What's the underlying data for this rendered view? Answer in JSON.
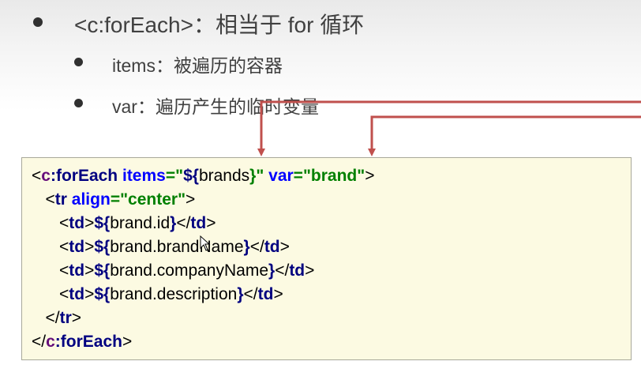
{
  "bullets": [
    {
      "text": "<c:forEach>：相当于 for 循环"
    },
    {
      "text": "items：被遍历的容器"
    },
    {
      "text": "var：遍历产生的临时变量"
    }
  ],
  "code": {
    "l1": {
      "lt": "<",
      "ns": "c",
      "colon": ":",
      "tag": "forEach",
      "sp1": " ",
      "attr1": "items",
      "eq1": "=\"",
      "dollar1": "${",
      "expr1": "brands",
      "close1": "}\"",
      "sp2": " ",
      "attr2": "var",
      "eq2": "=",
      "val2": "\"brand\"",
      "gt": ">"
    },
    "l2": {
      "indent": "   ",
      "lt": "<",
      "tag": "tr",
      "sp": " ",
      "attr": "align",
      "eq": "=",
      "val": "\"center\"",
      "gt": ">"
    },
    "l3": {
      "indent": "      ",
      "lt": "<",
      "tag": "td",
      "gt": ">",
      "dollar": "${",
      "expr": "brand.id",
      "close": "}",
      "lt2": "</",
      "tag2": "td",
      "gt2": ">"
    },
    "l4": {
      "indent": "      ",
      "lt": "<",
      "tag": "td",
      "gt": ">",
      "dollar": "${",
      "expr": "brand.brandName",
      "close": "}",
      "lt2": "</",
      "tag2": "td",
      "gt2": ">"
    },
    "l5": {
      "indent": "      ",
      "lt": "<",
      "tag": "td",
      "gt": ">",
      "dollar": "${",
      "expr": "brand.companyName",
      "close": "}",
      "lt2": "</",
      "tag2": "td",
      "gt2": ">"
    },
    "l6": {
      "indent": "      ",
      "lt": "<",
      "tag": "td",
      "gt": ">",
      "dollar": "${",
      "expr": "brand.description",
      "close": "}",
      "lt2": "</",
      "tag2": "td",
      "gt2": ">"
    },
    "l7": {
      "indent": "   ",
      "lt": "</",
      "tag": "tr",
      "gt": ">"
    },
    "l8": {
      "lt": "</",
      "ns": "c",
      "colon": ":",
      "tag": "forEach",
      "gt": ">"
    }
  },
  "colors": {
    "arrow": "#c0504d",
    "code_bg": "#fcfae2"
  }
}
